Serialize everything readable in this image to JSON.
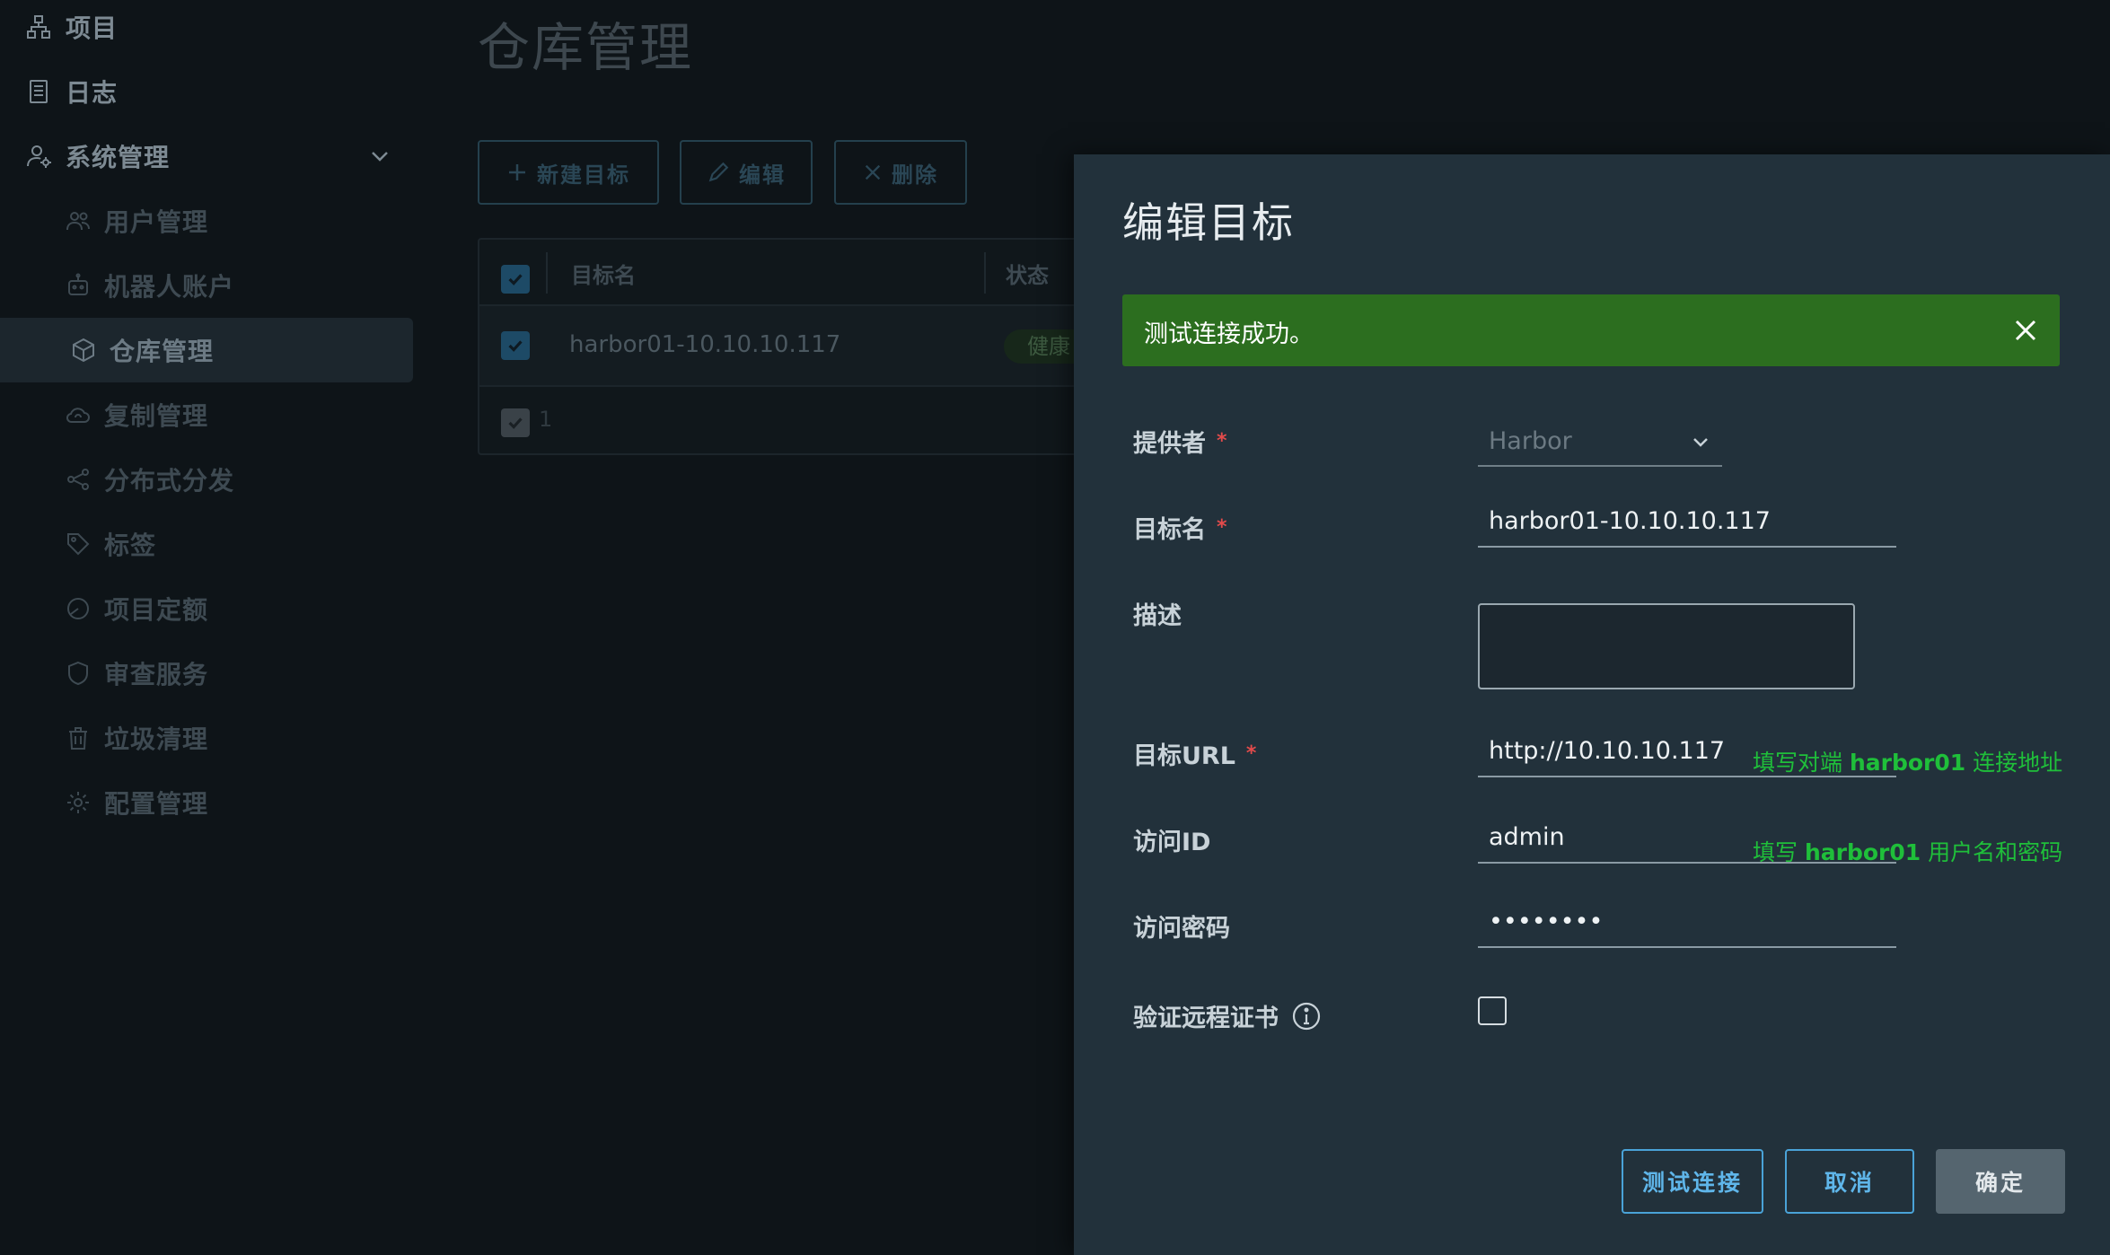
{
  "sidebar": {
    "items": [
      {
        "label": "项目",
        "icon": "project-icon"
      },
      {
        "label": "日志",
        "icon": "log-icon"
      },
      {
        "label": "系统管理",
        "icon": "system-admin-icon"
      },
      {
        "label": "用户管理",
        "icon": "users-icon"
      },
      {
        "label": "机器人账户",
        "icon": "robot-icon"
      },
      {
        "label": "仓库管理",
        "icon": "box-icon"
      },
      {
        "label": "复制管理",
        "icon": "cloud-sync-icon"
      },
      {
        "label": "分布式分发",
        "icon": "share-icon"
      },
      {
        "label": "标签",
        "icon": "tag-icon"
      },
      {
        "label": "项目定额",
        "icon": "quota-icon"
      },
      {
        "label": "审查服务",
        "icon": "shield-icon"
      },
      {
        "label": "垃圾清理",
        "icon": "trash-icon"
      },
      {
        "label": "配置管理",
        "icon": "gear-icon"
      }
    ]
  },
  "main": {
    "title": "仓库管理",
    "toolbar": {
      "new_label": "新建目标",
      "edit_label": "编辑",
      "delete_label": "删除"
    },
    "table": {
      "columns": [
        "目标名",
        "状态"
      ],
      "rows": [
        {
          "name": "harbor01-10.10.10.117",
          "status": "健康"
        }
      ],
      "footer_count": "1"
    }
  },
  "modal": {
    "title": "编辑目标",
    "alert": "测试连接成功。",
    "fields": {
      "provider": {
        "label": "提供者",
        "value": "Harbor"
      },
      "name": {
        "label": "目标名",
        "value": "harbor01-10.10.10.117"
      },
      "description": {
        "label": "描述",
        "value": ""
      },
      "url": {
        "label": "目标URL",
        "value": "http://10.10.10.117"
      },
      "access_id": {
        "label": "访问ID",
        "value": "admin"
      },
      "password": {
        "label": "访问密码",
        "value": "••••••••"
      },
      "verify_cert": {
        "label": "验证远程证书",
        "checked": false
      }
    },
    "annotations": {
      "url_prefix": "填写对端",
      "url_bold": "harbor01",
      "url_suffix": "连接地址",
      "cred_prefix": "填写",
      "cred_bold": "harbor01",
      "cred_suffix": "用户名和密码"
    },
    "buttons": {
      "test": "测试连接",
      "cancel": "取消",
      "ok": "确定"
    }
  },
  "colors": {
    "background": "#0e1418",
    "modal": "#22313b",
    "alert_success": "#2c6e1f",
    "accent_blue": "#4aa3d8",
    "annotation_green": "#1fbf3a",
    "required_red": "#e34b4b"
  }
}
